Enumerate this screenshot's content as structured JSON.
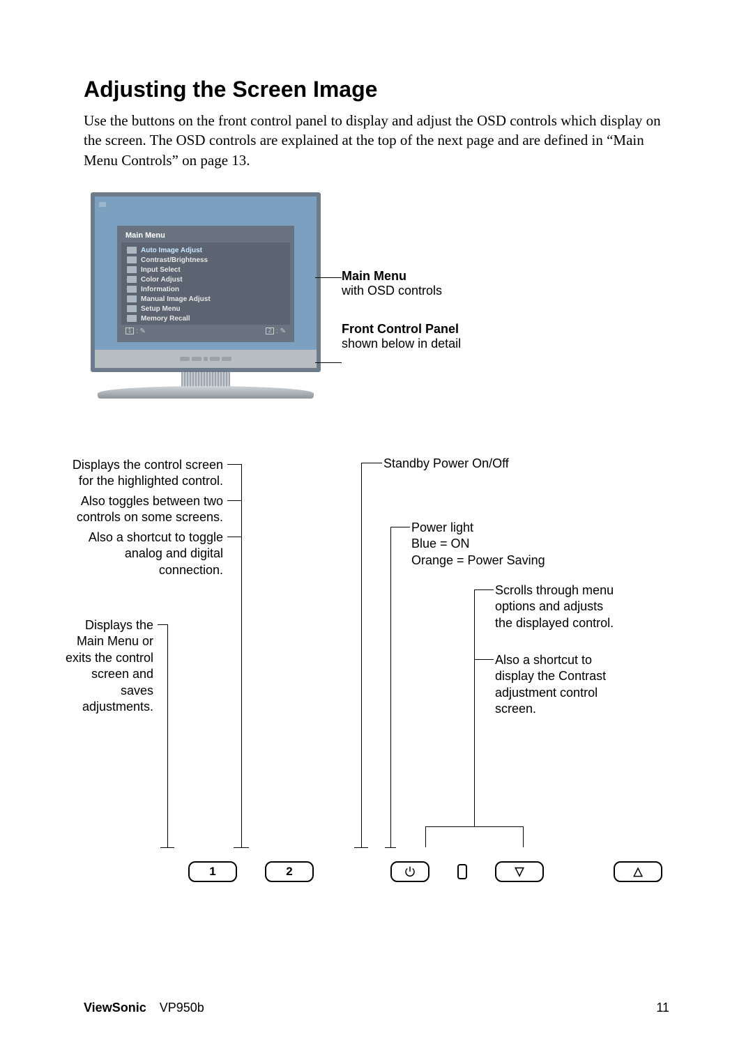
{
  "heading": "Adjusting the Screen Image",
  "intro": "Use the buttons on the front control panel to display and adjust the OSD controls which display on the screen. The OSD controls are explained at the top of the next page and are defined in “Main Menu Controls” on page 13.",
  "osd": {
    "title": "Main Menu",
    "items": [
      "Auto Image Adjust",
      "Contrast/Brightness",
      "Input Select",
      "Color Adjust",
      "Information",
      "Manual Image Adjust",
      "Setup Menu",
      "Memory Recall"
    ],
    "foot_left": "1",
    "foot_right": "2"
  },
  "side": {
    "main_menu_title": "Main Menu",
    "main_menu_sub": "with OSD controls",
    "panel_title": "Front Control Panel",
    "panel_sub": "shown below in detail"
  },
  "callouts": {
    "left1a": "Displays the control screen for the highlighted control.",
    "left1b": "Also toggles between two controls on some screens.",
    "left1c": "Also a shortcut to toggle analog and digital connection.",
    "left2": "Displays the Main Menu or exits the control screen and saves adjustments.",
    "standby": "Standby Power On/Off",
    "powerlight_a": "Power light",
    "powerlight_b": "Blue = ON",
    "powerlight_c": "Orange = Power Saving",
    "scroll_a": "Scrolls through menu options and adjusts the displayed control.",
    "scroll_b": "Also a shortcut to display the Contrast adjustment control screen."
  },
  "buttons": {
    "b1": "1",
    "b2": "2",
    "power": "⏻",
    "down": "▽",
    "up": "△"
  },
  "footer": {
    "brand": "ViewSonic",
    "model": "VP950b",
    "page": "11"
  }
}
